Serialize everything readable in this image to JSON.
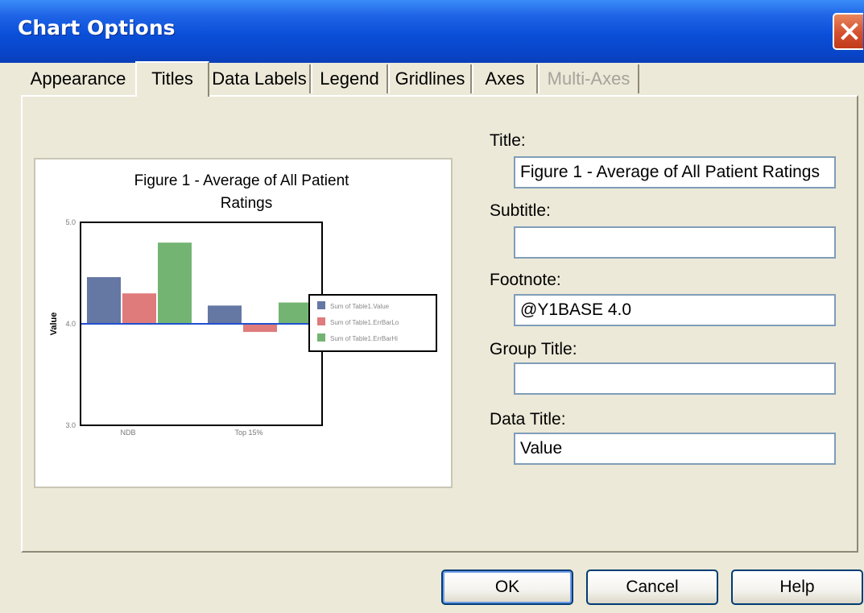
{
  "window": {
    "title": "Chart Options"
  },
  "tabs": [
    {
      "label": "Appearance",
      "state": "normal"
    },
    {
      "label": "Titles",
      "state": "active"
    },
    {
      "label": "Data Labels",
      "state": "normal"
    },
    {
      "label": "Legend",
      "state": "normal"
    },
    {
      "label": "Gridlines",
      "state": "normal"
    },
    {
      "label": "Axes",
      "state": "normal"
    },
    {
      "label": "Multi-Axes",
      "state": "disabled"
    }
  ],
  "form": {
    "title_label": "Title:",
    "title_value": "Figure 1 - Average of All Patient Ratings",
    "subtitle_label": "Subtitle:",
    "subtitle_value": "",
    "footnote_label": "Footnote:",
    "footnote_value": "@Y1BASE 4.0",
    "group_title_label": "Group Title:",
    "group_title_value": "",
    "data_title_label": "Data Title:",
    "data_title_value": "Value"
  },
  "buttons": {
    "ok": "OK",
    "cancel": "Cancel",
    "help": "Help"
  },
  "colors": {
    "series1": "#6577a3",
    "series2": "#e07b7b",
    "series3": "#73b473",
    "baseline": "#2050d0"
  },
  "chart_data": {
    "type": "bar",
    "title_lines": [
      "Figure 1 - Average of All Patient",
      "Ratings"
    ],
    "ylabel": "Value",
    "ylim": [
      3.0,
      5.0
    ],
    "base": 4.0,
    "yticks": [
      "3.0",
      "4.0",
      "5.0"
    ],
    "categories": [
      "NDB",
      "Top 15%"
    ],
    "series": [
      {
        "name": "Sum of Table1.Value",
        "values": [
          4.46,
          4.18
        ]
      },
      {
        "name": "Sum of Table1.ErrBarLo",
        "values": [
          4.3,
          3.92
        ]
      },
      {
        "name": "Sum of Table1.ErrBarHi",
        "values": [
          4.8,
          4.21
        ]
      }
    ],
    "legend_position": "right"
  }
}
